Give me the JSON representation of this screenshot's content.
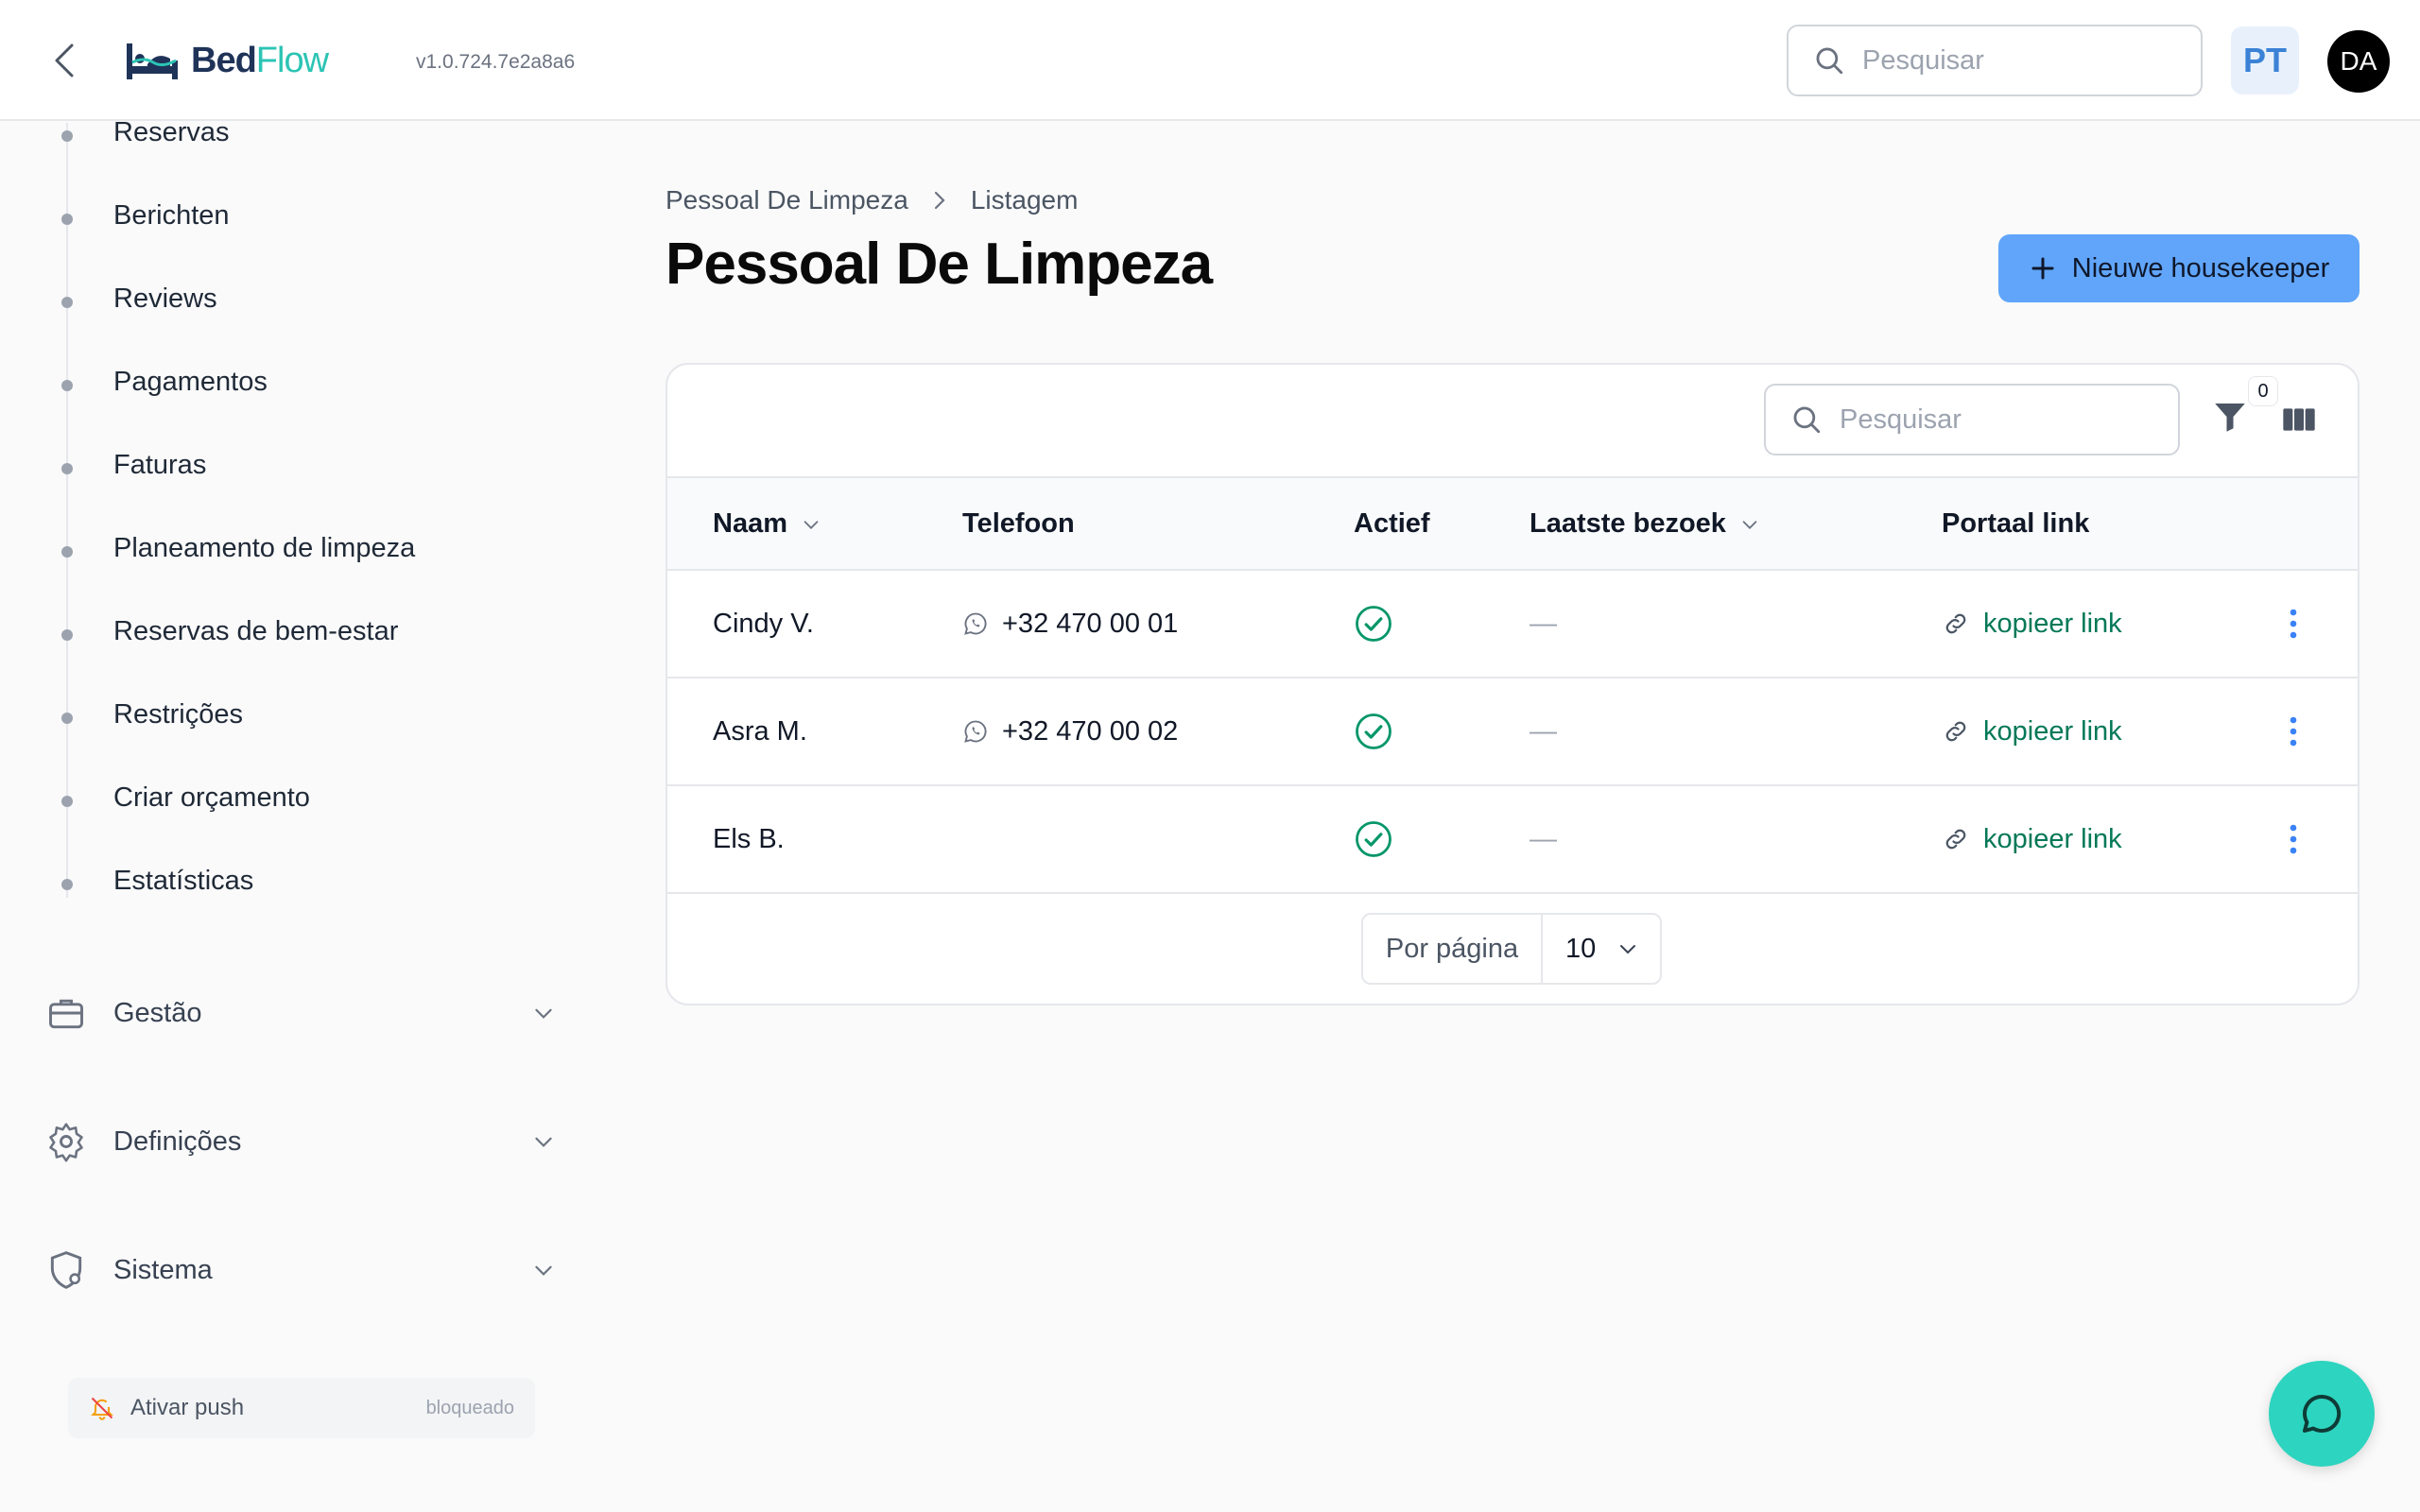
{
  "header": {
    "logo_part1": "Bed",
    "logo_part2": "Flow",
    "version": "v1.0.724.7e2a8a6",
    "search_placeholder": "Pesquisar",
    "language": "PT",
    "avatar_initials": "DA"
  },
  "sidebar": {
    "items": [
      "Reservas",
      "Berichten",
      "Reviews",
      "Pagamentos",
      "Faturas",
      "Planeamento de limpeza",
      "Reservas de bem-estar",
      "Restrições",
      "Criar orçamento",
      "Estatísticas"
    ],
    "groups": [
      "Gestão",
      "Definições",
      "Sistema"
    ],
    "push_label": "Ativar push",
    "push_status": "bloqueado"
  },
  "main": {
    "breadcrumb": [
      "Pessoal De Limpeza",
      "Listagem"
    ],
    "title": "Pessoal De Limpeza",
    "new_button": "Nieuwe housekeeper",
    "table": {
      "search_placeholder": "Pesquisar",
      "filter_count": "0",
      "columns": [
        "Naam",
        "Telefoon",
        "Actief",
        "Laatste bezoek",
        "Portaal link"
      ],
      "rows": [
        {
          "name": "Cindy V.",
          "phone": "+32 470 00 01",
          "last_visit": "—",
          "link": "kopieer link"
        },
        {
          "name": "Asra M.",
          "phone": "+32 470 00 02",
          "last_visit": "—",
          "link": "kopieer link"
        },
        {
          "name": "Els B.",
          "phone": "",
          "last_visit": "—",
          "link": "kopieer link"
        }
      ],
      "per_page_label": "Por página",
      "per_page_value": "10"
    }
  },
  "colors": {
    "accent_blue": "#60a5fa",
    "brand_teal": "#2cc4b4",
    "active_green": "#059669",
    "link_green": "#047857"
  }
}
